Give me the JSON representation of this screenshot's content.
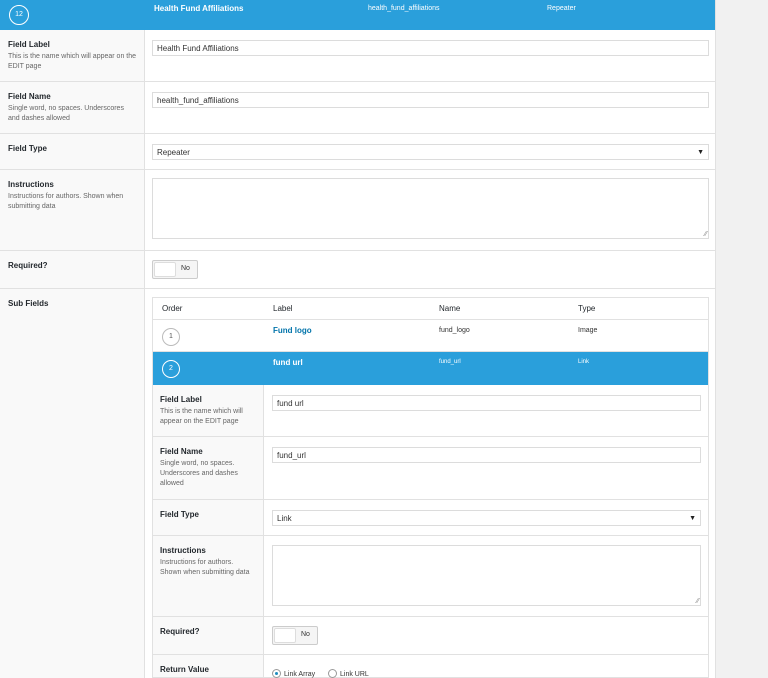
{
  "header": {
    "order": "12",
    "label": "Health Fund Affiliations",
    "name": "health_fund_affiliations",
    "type": "Repeater"
  },
  "fields": {
    "field_label": {
      "label": "Field Label",
      "desc": "This is the name which will appear on the EDIT page",
      "value": "Health Fund Affiliations"
    },
    "field_name": {
      "label": "Field Name",
      "desc": "Single word, no spaces. Underscores and dashes allowed",
      "value": "health_fund_affiliations"
    },
    "field_type": {
      "label": "Field Type",
      "value": "Repeater"
    },
    "instructions": {
      "label": "Instructions",
      "desc": "Instructions for authors. Shown when submitting data",
      "value": ""
    },
    "required": {
      "label": "Required?",
      "toggle": "No"
    },
    "sub_fields": {
      "label": "Sub Fields"
    }
  },
  "sub_table": {
    "headers": [
      "Order",
      "Label",
      "Name",
      "Type"
    ],
    "rows": [
      {
        "order": "1",
        "label": "Fund logo",
        "name": "fund_logo",
        "type": "Image"
      },
      {
        "order": "2",
        "label": "fund url",
        "name": "fund_url",
        "type": "Link"
      }
    ],
    "edit": {
      "field_label": {
        "label": "Field Label",
        "desc": "This is the name which will appear on the EDIT page",
        "value": "fund url"
      },
      "field_name": {
        "label": "Field Name",
        "desc": "Single word, no spaces. Underscores and dashes allowed",
        "value": "fund_url"
      },
      "field_type": {
        "label": "Field Type",
        "value": "Link"
      },
      "instructions": {
        "label": "Instructions",
        "desc": "Instructions for authors. Shown when submitting data",
        "value": ""
      },
      "required": {
        "label": "Required?",
        "toggle": "No"
      },
      "return_value": {
        "label": "Return Value",
        "options": [
          "Link Array",
          "Link URL"
        ],
        "selected": "Link Array"
      }
    }
  },
  "icons": {
    "select_arrow": "caret-down-icon",
    "resize": "resize-grip-icon"
  },
  "colors": {
    "accent": "#2a9fdb",
    "link": "#0073aa"
  }
}
